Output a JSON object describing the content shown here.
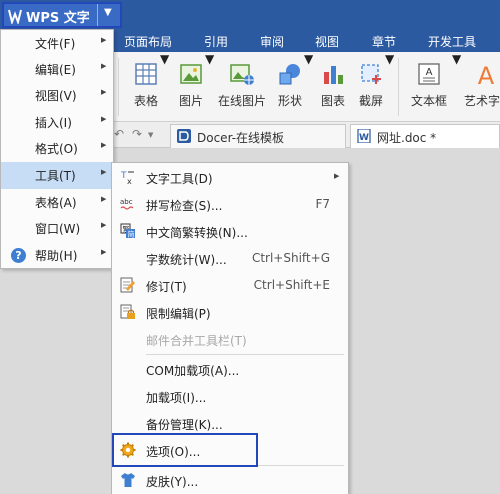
{
  "app": {
    "title": "WPS 文字",
    "colors": {
      "titlebar": "#2c5aa0",
      "highlight_border": "#2346b8",
      "menu_hover": "#c7ddf5"
    }
  },
  "ribbon_tabs": [
    "页面布局",
    "引用",
    "审阅",
    "视图",
    "章节",
    "开发工具"
  ],
  "ribbon": {
    "buttons": [
      {
        "label": "表格",
        "icon": "table-icon",
        "dropdown": true
      },
      {
        "label": "图片",
        "icon": "picture-icon",
        "dropdown": true
      },
      {
        "label": "在线图片",
        "icon": "online-picture-icon",
        "dropdown": false
      },
      {
        "label": "形状",
        "icon": "shapes-icon",
        "dropdown": true
      },
      {
        "label": "图表",
        "icon": "chart-icon",
        "dropdown": false
      },
      {
        "label": "截屏",
        "icon": "screenshot-icon",
        "dropdown": true
      },
      {
        "label": "文本框",
        "icon": "textbox-icon",
        "dropdown": true
      },
      {
        "label": "艺术字",
        "icon": "wordart-icon",
        "dropdown": false
      }
    ]
  },
  "doc_tabs": [
    {
      "title": "Docer-在线模板",
      "icon": "docer-icon"
    },
    {
      "title": "网址.doc *",
      "icon": "doc-icon"
    }
  ],
  "main_menu": {
    "items": [
      {
        "label": "文件(F)",
        "arrow": true
      },
      {
        "label": "编辑(E)",
        "arrow": true
      },
      {
        "label": "视图(V)",
        "arrow": true
      },
      {
        "label": "插入(I)",
        "arrow": true
      },
      {
        "label": "格式(O)",
        "arrow": true
      },
      {
        "label": "工具(T)",
        "arrow": true,
        "highlighted": true
      },
      {
        "label": "表格(A)",
        "arrow": true
      },
      {
        "label": "窗口(W)",
        "arrow": true
      },
      {
        "label": "帮助(H)",
        "arrow": true,
        "icon": "help-icon"
      }
    ]
  },
  "tools_menu": {
    "items": [
      {
        "label": "文字工具(D)",
        "icon": "text-tools-icon",
        "submenu": true
      },
      {
        "label": "拼写检查(S)...",
        "icon": "spell-check-icon",
        "shortcut": "F7"
      },
      {
        "label": "中文简繁转换(N)...",
        "icon": "chinese-convert-icon"
      },
      {
        "label": "字数统计(W)...",
        "shortcut": "Ctrl+Shift+G"
      },
      {
        "label": "修订(T)",
        "icon": "revision-icon",
        "shortcut": "Ctrl+Shift+E"
      },
      {
        "label": "限制编辑(P)",
        "icon": "lock-icon"
      },
      {
        "label": "邮件合并工具栏(T)",
        "disabled": true
      },
      {
        "label": "COM加载项(A)..."
      },
      {
        "label": "加载项(I)..."
      },
      {
        "label": "备份管理(K)..."
      },
      {
        "label": "选项(O)...",
        "icon": "gear-icon",
        "outlined": true
      },
      {
        "label": "皮肤(Y)...",
        "icon": "shirt-icon"
      }
    ]
  }
}
